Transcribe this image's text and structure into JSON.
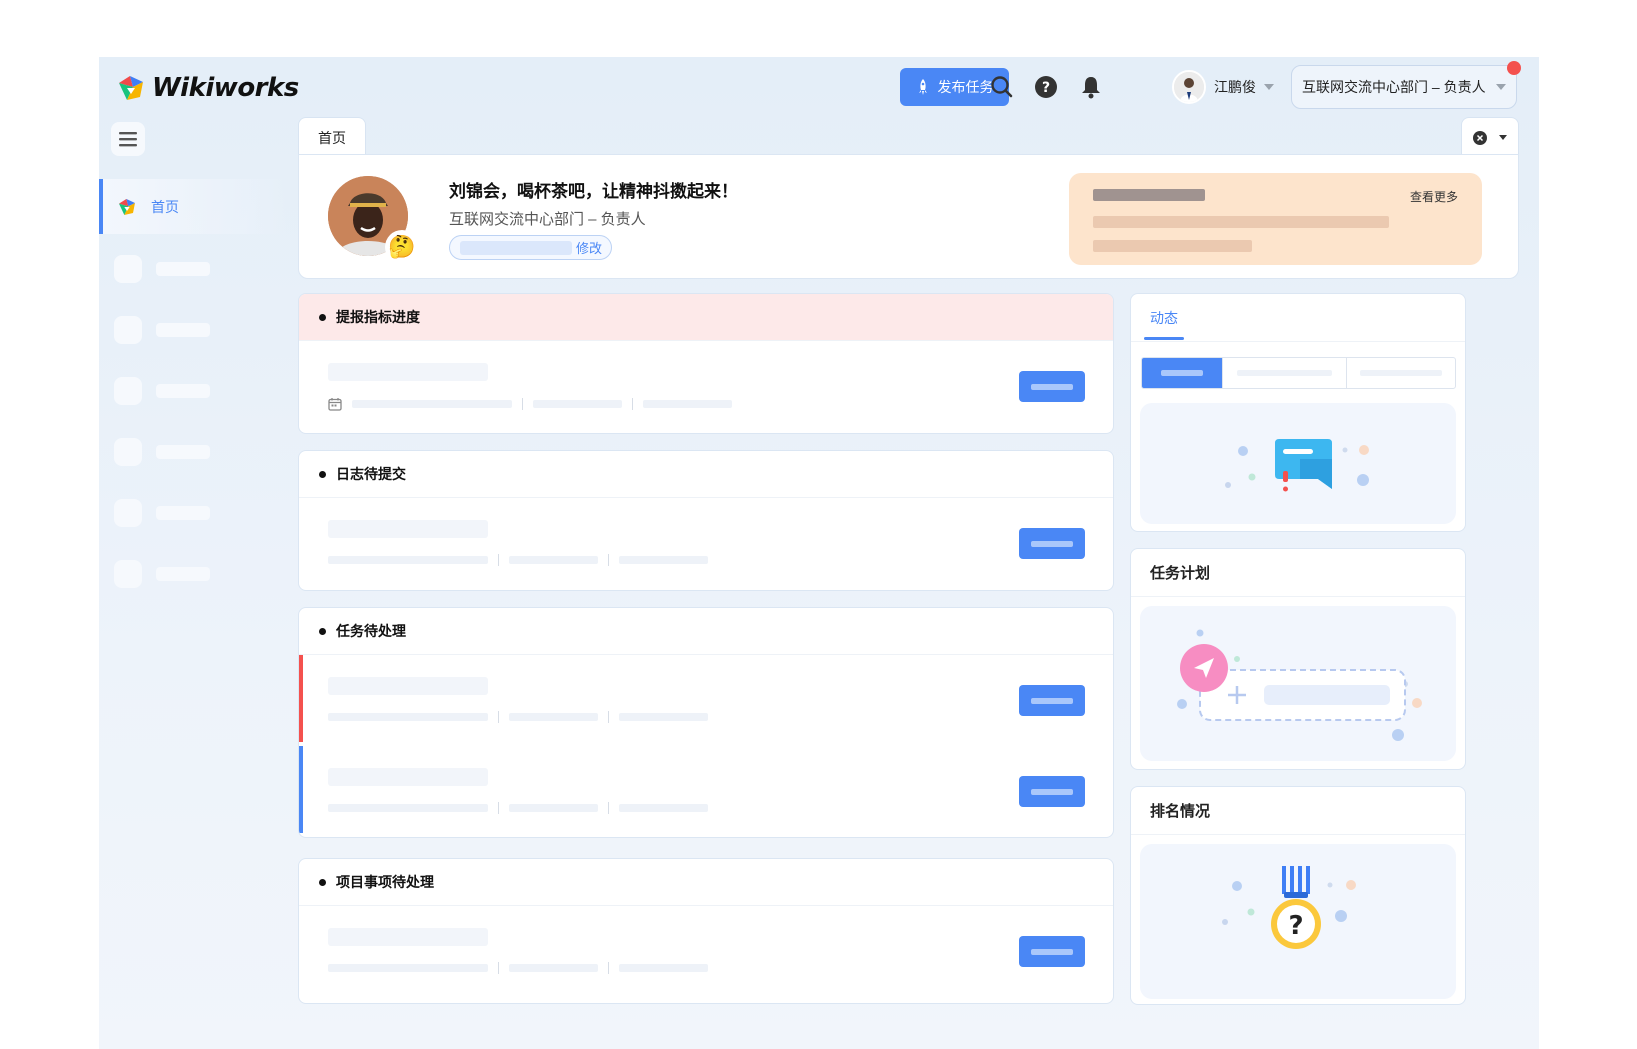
{
  "header": {
    "logo_text": "Wikiworks",
    "publish_label": "发布任务",
    "user_name": "江鹏俊",
    "dept_select": "互联网交流中心部门 – 负责人",
    "icons": [
      "search-icon",
      "help-icon",
      "bell-icon"
    ]
  },
  "sidebar": {
    "active_item": "首页"
  },
  "tabs": {
    "home": "首页"
  },
  "welcome": {
    "greeting": "刘锦会，喝杯茶吧，让精神抖擞起来！",
    "dept": "互联网交流中心部门 – 负责人",
    "edit_label": "修改",
    "emoji": "🤔",
    "notice_more": "查看更多"
  },
  "sections": [
    {
      "title": "提报指标进度"
    },
    {
      "title": "日志待提交"
    },
    {
      "title": "任务待处理"
    },
    {
      "title": "项目事项待处理"
    }
  ],
  "panels": {
    "activity_tab": "动态",
    "task_plan": "任务计划",
    "ranking": "排名情况"
  },
  "colors": {
    "accent": "#4a87f5",
    "flag_red": "#f4514e",
    "flag_blue": "#4a87f5",
    "notice_bg": "#fde4cc",
    "alert_bg": "#fde9e9"
  }
}
